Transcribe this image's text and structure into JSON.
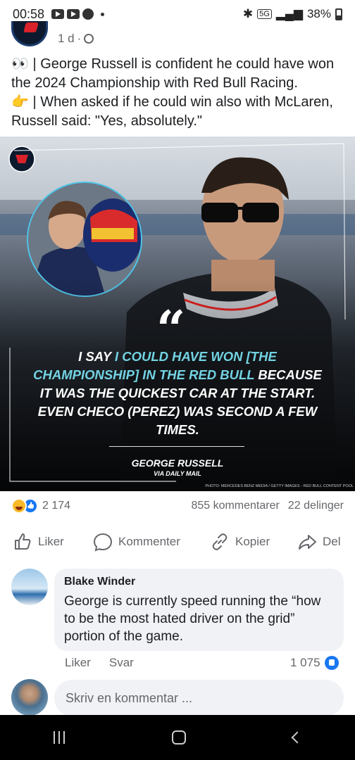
{
  "status_bar": {
    "time": "00:58",
    "battery": "38%",
    "network": "5G"
  },
  "post": {
    "age": "1 d",
    "separator": "·",
    "text_line1": "👀 | George Russell is confident he could have won the 2024 Championship with Red Bull Racing.",
    "text_line2": "👉 | When asked if he could win also with McLaren, Russell said: \"Yes, absolutely.\""
  },
  "image": {
    "quote_mark": "“",
    "quote_part1": "I say ",
    "quote_highlight": "I could have won [the championship] in the Red Bull",
    "quote_part2": " because it was the quickest car at the start. Even Checo (Perez) was second a few times.",
    "author": "GEORGE RUSSELL",
    "source": "VIA DAILY MAIL",
    "credit": "PHOTO: MERCEDES BENZ MEDIA / GETTY IMAGES - RED BULL CONTENT POOL"
  },
  "reactions": {
    "count": "2 174",
    "comments": "855 kommentarer",
    "shares": "22 delinger"
  },
  "actions": {
    "like": "Liker",
    "comment": "Kommenter",
    "copy": "Kopier",
    "share": "Del"
  },
  "comment": {
    "author": "Blake Winder",
    "text": "George is currently speed running the “how to be the most hated driver on the grid” portion of the game.",
    "like": "Liker",
    "reply": "Svar",
    "likes": "1 075"
  },
  "compose": {
    "placeholder": "Skriv en kommentar ..."
  },
  "colors": {
    "fb_blue": "#1877f2",
    "quote_highlight": "#73d3e3",
    "meta_gray": "#65676b"
  }
}
